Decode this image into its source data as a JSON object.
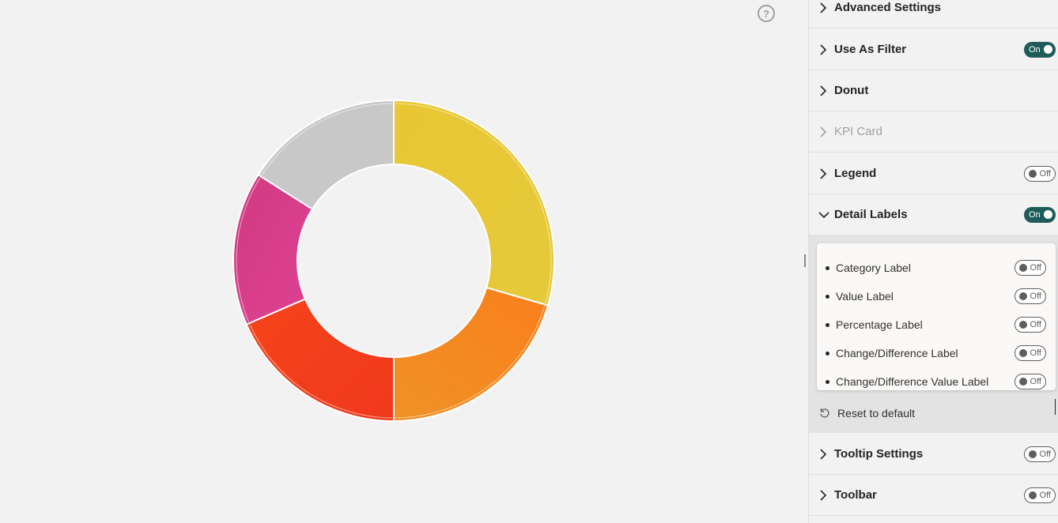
{
  "canvas": {
    "help_icon": "question-circle-icon",
    "chart_data": {
      "type": "pie",
      "style": "donut",
      "categories": [
        "",
        "",
        "",
        "",
        ""
      ],
      "values": [
        29.5,
        20.5,
        18.5,
        15.5,
        16
      ],
      "colors": [
        "#e8c832",
        "#f7871e",
        "#f43e1c",
        "#d83f8a",
        "#c8c8c8"
      ],
      "start_angle_deg": 0,
      "legend": "none",
      "labels": "none"
    }
  },
  "panel": {
    "sections": [
      {
        "title": "Advanced Settings",
        "toggle": null,
        "disabled": false,
        "expanded": false
      },
      {
        "title": "Use As Filter",
        "toggle": "On",
        "disabled": false,
        "expanded": false
      },
      {
        "title": "Donut",
        "toggle": null,
        "disabled": false,
        "expanded": false
      },
      {
        "title": "KPI Card",
        "toggle": null,
        "disabled": true,
        "expanded": false
      },
      {
        "title": "Legend",
        "toggle": "Off",
        "disabled": false,
        "expanded": false
      },
      {
        "title": "Detail Labels",
        "toggle": "On",
        "disabled": false,
        "expanded": true
      },
      {
        "title": "Tooltip Settings",
        "toggle": "Off",
        "disabled": false,
        "expanded": false
      },
      {
        "title": "Toolbar",
        "toggle": "Off",
        "disabled": false,
        "expanded": false
      }
    ],
    "detail_labels": {
      "items": [
        {
          "label": "Category Label",
          "toggle": "Off"
        },
        {
          "label": "Value Label",
          "toggle": "Off"
        },
        {
          "label": "Percentage Label",
          "toggle": "Off"
        },
        {
          "label": "Change/Difference Label",
          "toggle": "Off"
        },
        {
          "label": "Change/Difference Value Label",
          "toggle": "Off"
        }
      ],
      "reset_label": "Reset to default",
      "reset_icon": "undo-icon"
    }
  }
}
